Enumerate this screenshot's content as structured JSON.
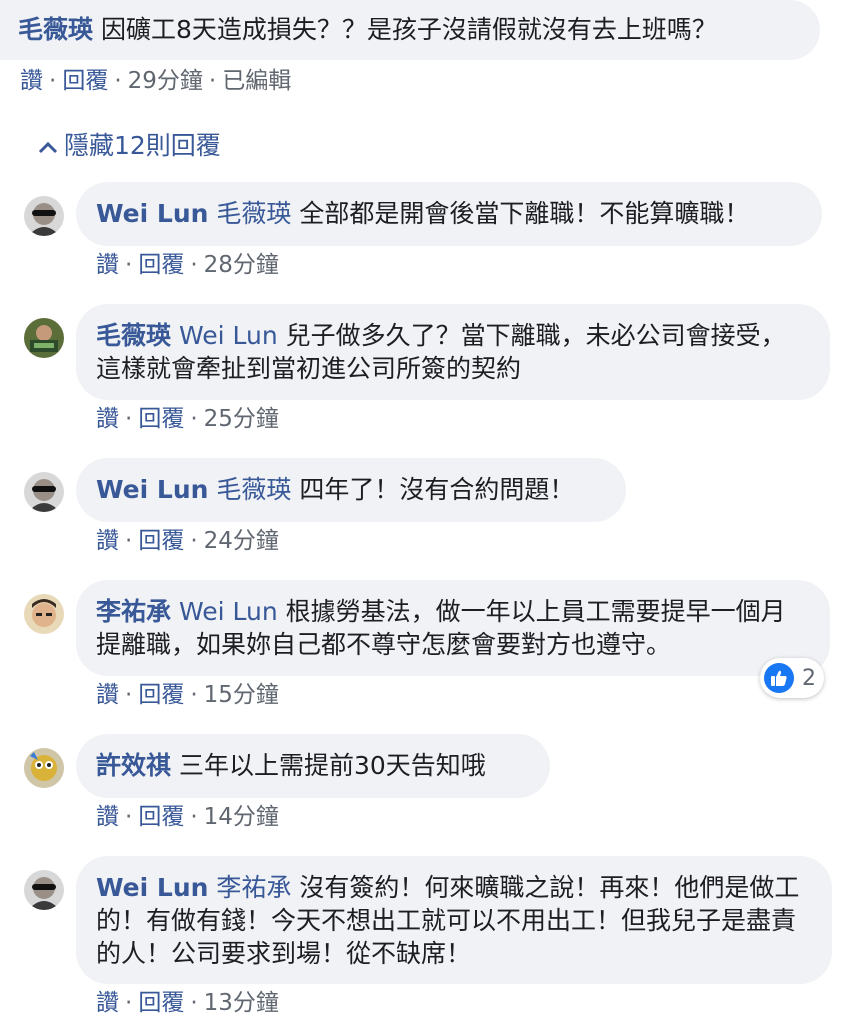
{
  "top_comment": {
    "author": "毛薇瑛",
    "text": "因礦工8天造成損失？？是孩子沒請假就沒有去上班嗎？",
    "like_label": "讚",
    "reply_label": "回覆",
    "time": "29分鐘",
    "edited_label": "已編輯"
  },
  "hide_replies": {
    "label": "隱藏12則回覆"
  },
  "replies": [
    {
      "author": "Wei Lun",
      "mention": "毛薇瑛",
      "text": "全部都是開會後當下離職！不能算曠職！",
      "like_label": "讚",
      "reply_label": "回覆",
      "time": "28分鐘"
    },
    {
      "author": "毛薇瑛",
      "mention": "Wei Lun",
      "text": "兒子做多久了？當下離職，未必公司會接受，這樣就會牽扯到當初進公司所簽的契約",
      "like_label": "讚",
      "reply_label": "回覆",
      "time": "25分鐘"
    },
    {
      "author": "Wei Lun",
      "mention": "毛薇瑛",
      "text": "四年了！沒有合約問題！",
      "like_label": "讚",
      "reply_label": "回覆",
      "time": "24分鐘"
    },
    {
      "author": "李祐承",
      "mention": "Wei Lun",
      "text": "根據勞基法，做一年以上員工需要提早一個月提離職，如果妳自己都不尊守怎麼會要對方也遵守。",
      "like_label": "讚",
      "reply_label": "回覆",
      "time": "15分鐘",
      "reaction_count": "2"
    },
    {
      "author": "許效祺",
      "mention": "",
      "text": "三年以上需提前30天告知哦",
      "like_label": "讚",
      "reply_label": "回覆",
      "time": "14分鐘"
    },
    {
      "author": "Wei Lun",
      "mention": "李祐承",
      "text": "沒有簽約！何來曠職之說！再來！他們是做工的！有做有錢！今天不想出工就可以不用出工！但我兒子是盡責的人！公司要求到場！從不缺席！",
      "like_label": "讚",
      "reply_label": "回覆",
      "time": "13分鐘"
    }
  ],
  "icons": {
    "hide": "chevron-up-icon",
    "reaction": "like-thumb-icon"
  },
  "colors": {
    "link": "#385898",
    "bubble": "#f0f2f5",
    "meta": "#606770",
    "like": "#1877f2"
  }
}
